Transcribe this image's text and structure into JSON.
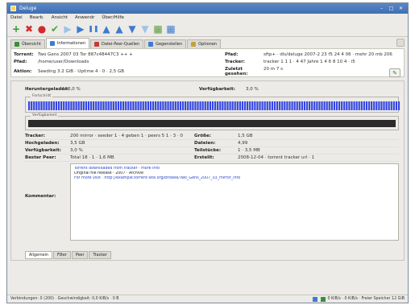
{
  "window": {
    "title": "Deluge",
    "controls": [
      "–",
      "□",
      "✕"
    ]
  },
  "menu": [
    "Datei",
    "Bearb.",
    "Ansicht",
    "Anwendr",
    "Über/Hilfe"
  ],
  "toolbar": {
    "buttons": [
      {
        "name": "add-torrent-button",
        "glyph": "+",
        "color": "#2a9d2a"
      },
      {
        "name": "remove-torrent-button",
        "glyph": "✖",
        "color": "#d22a2a"
      },
      {
        "name": "no-entry-button",
        "glyph": "●",
        "color": "#d22a2a"
      },
      {
        "name": "check-button",
        "glyph": "✔",
        "color": "#4aa43c"
      },
      {
        "name": "play-button",
        "glyph": "▶",
        "color": "#9ec3e6"
      },
      {
        "name": "resume-button",
        "glyph": "▶",
        "color": "#3d7bd0"
      },
      {
        "name": "pause-button",
        "glyph": "❚❚",
        "color": "#3d7bd0"
      },
      {
        "name": "queue-up-button",
        "glyph": "▲",
        "color": "#3d7bd0"
      },
      {
        "name": "queue-up-alt-button",
        "glyph": "▲",
        "color": "#3d7bd0"
      },
      {
        "name": "queue-down-button",
        "glyph": "▼",
        "color": "#3d7bd0"
      },
      {
        "name": "queue-bottom-button",
        "glyph": "▼",
        "color": "#9ec3e6"
      },
      {
        "name": "preferences-button",
        "glyph": "▦",
        "color": "#5a9b3c"
      },
      {
        "name": "connection-button",
        "glyph": "▦",
        "color": "#3d7bd0"
      }
    ]
  },
  "tabs": [
    {
      "label": "Übersicht",
      "color": "#3a8f3a"
    },
    {
      "label": "Informationen",
      "color": "#3d7bd0",
      "active": true
    },
    {
      "label": "Datei-Peer-Quellen",
      "color": "#c23b3b"
    },
    {
      "label": "Gegenstellen",
      "color": "#3d7bd0"
    },
    {
      "label": "Optionen",
      "color": "#c3a23b"
    }
  ],
  "info": {
    "row1": {
      "label": "Torrent:",
      "value": "Two Gens 2007 03 Tor 887c48447C3 ++ +",
      "label2": "Pfad:",
      "value2": "sftp+ · dls/deluge 2007-2 23 f5 24 4 06 · mehr 20 mb 206"
    },
    "row2": {
      "label": "Pfad:",
      "value": "/home/user/Downloads",
      "label2": "Tracker:",
      "value2": "tracker 1 1 1 · 4 47 Jahre 1 4 6 8 10 4 · i5"
    },
    "row3": {
      "label": "Aktion:",
      "value": "Seeding 3.2 GiB · Uptime 4 · 0 · 2,5 GB",
      "label2": "Zuletzt gesehen:",
      "value2": "20 m 7 s"
    }
  },
  "pieces": {
    "label": "Heruntergeladen:",
    "value": "100,0 %",
    "label2": "Verfügbarkeit:",
    "value2": "3,0 %",
    "frame1": "Fortschritt",
    "frame2": "Verfügbarkeit",
    "bar_color": "#3346e3",
    "avail_color": "#2b2b2b"
  },
  "details": {
    "rows": [
      {
        "l": "Tracker:",
        "v": "200 mirror · seeder 1 · 4 geben 1 · peers 5 1 · 3 · 0",
        "l2": "Größe:",
        "v2": "1,5 GB"
      },
      {
        "l": "Hochgeladen:",
        "v": "3,5 GB",
        "l2": "Dateien:",
        "v2": "4,99"
      },
      {
        "l": "Verfügbarkeit:",
        "v": "3,0 %",
        "l2": "Teilstücke:",
        "v2": "1 · 3,5 MB"
      },
      {
        "l": "Bester Peer:",
        "v": "Total 18 · 1 · 1,6 MB",
        "l2": "Erstellt:",
        "v2": "2008-12-04 · torrent tracker url · 1"
      }
    ]
  },
  "comment": {
    "label": "Kommentar:",
    "lines": [
      {
        "text": "Torrent downloaded from tracker · more info",
        "link": true
      },
      {
        "text": "Original file release · 2007 · Archive",
        "link": false
      },
      {
        "text": "For more visit · http://example.torrent-site.org/browse/Two_Gens_2007_03_mirror_info",
        "link": true
      }
    ]
  },
  "bottom_tabs": [
    "Allgemein",
    "Filter",
    "Peer",
    "Tracker"
  ],
  "status": {
    "left": "Verbindungen: 0 (200) · Geschwindigkeit: 0,0 KiB/s · 0 B",
    "right": "0 KiB/s  ·  0 KiB/s  ·  Freier Speicher 12 GiB"
  }
}
